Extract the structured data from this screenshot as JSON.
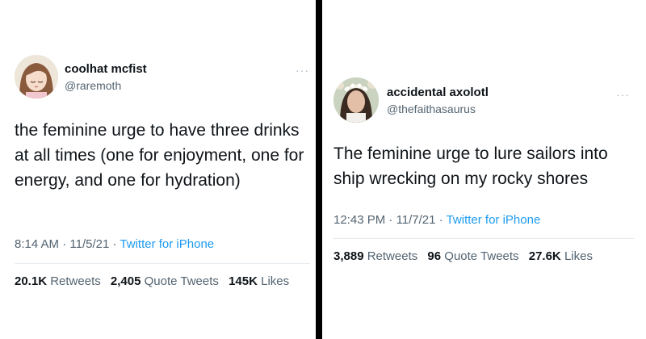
{
  "tweets": [
    {
      "display_name": "coolhat mcfist",
      "handle": "@raremoth",
      "more": "···",
      "text": "the feminine urge to have three drinks at all times (one for enjoyment, one for energy, and one for hydration)",
      "time": "8:14 AM",
      "date": "11/5/21",
      "source": "Twitter for iPhone",
      "retweets_count": "20.1K",
      "retweets_label": "Retweets",
      "quotes_count": "2,405",
      "quotes_label": "Quote Tweets",
      "likes_count": "145K",
      "likes_label": "Likes"
    },
    {
      "display_name": "accidental axolotl",
      "handle": "@thefaithasaurus",
      "more": "···",
      "text": "The feminine urge to lure sailors into ship wrecking on my rocky shores",
      "time": "12:43 PM",
      "date": "11/7/21",
      "source": "Twitter for iPhone",
      "retweets_count": "3,889",
      "retweets_label": "Retweets",
      "quotes_count": "96",
      "quotes_label": "Quote Tweets",
      "likes_count": "27.6K",
      "likes_label": "Likes"
    }
  ],
  "colors": {
    "text": "#0f1419",
    "secondary": "#536471",
    "link": "#1d9bf0",
    "divider": "#000000"
  }
}
